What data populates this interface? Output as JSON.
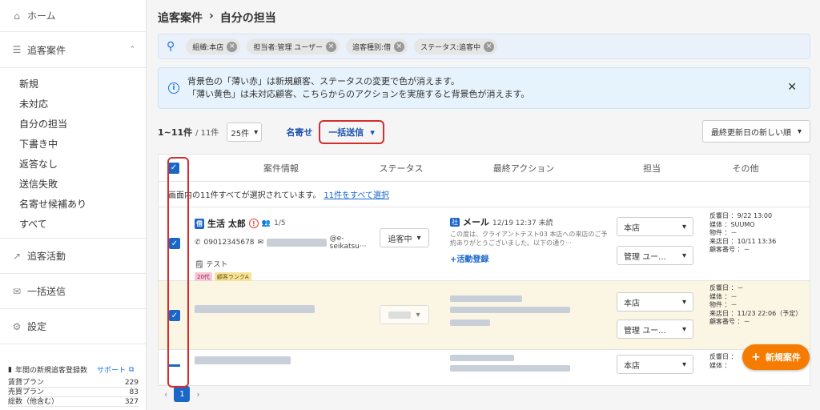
{
  "sidebar": {
    "home": "ホーム",
    "section_title": "追客案件",
    "sub_items": [
      "新規",
      "未対応",
      "自分の担当",
      "下書き中",
      "返答なし",
      "送信失敗",
      "名寄せ候補あり",
      "すべて"
    ],
    "activity": "追客活動",
    "bulk_send": "一括送信",
    "settings": "設定",
    "footer": {
      "title": "年間の新規追客登録数",
      "support": "サポート",
      "rows": [
        {
          "label": "賃貸プラン",
          "value": "229"
        },
        {
          "label": "売買プラン",
          "value": "83"
        },
        {
          "label": "総数（他含む）",
          "value": "327"
        }
      ]
    }
  },
  "breadcrumb": {
    "parent": "追客案件",
    "sep": "›",
    "current": "自分の担当"
  },
  "filters": [
    "組織:本店",
    "担当者:管理 ユーザー",
    "追客種別:借",
    "ステータス:追客中"
  ],
  "notice": {
    "line1": "背景色の「薄い赤」は新規顧客、ステータスの変更で色が消えます。",
    "line2": "「薄い黄色」は未対応顧客、こちらからのアクションを実施すると背景色が消えます。"
  },
  "toolbar": {
    "count": "1~11件",
    "total": "/ 11件",
    "per_page": "25件",
    "merge": "名寄せ",
    "bulk_send": "一括送信",
    "sort": "最終更新日の新しい順"
  },
  "table": {
    "headers": [
      "案件情報",
      "ステータス",
      "最終アクション",
      "担当",
      "その他"
    ],
    "select_note": "画面内の11件すべてが選択されています。",
    "select_all_link": "11件をすべて選択",
    "row1": {
      "tag": "借",
      "name": "生活 太郎",
      "count": "1/5",
      "phone": "09012345678",
      "email_suffix": "@e-seikatsu···",
      "memo": "テスト",
      "badges": [
        "20代",
        "顧客ランクA"
      ],
      "status": "追客中",
      "action_tag": "社",
      "action_type": "メール",
      "action_time": "12/19 12:37 未読",
      "action_body": "この度は、クライアントテスト03 本店への来店のご予約ありがとうございました。以下の通り···",
      "add_activity": "+活動登録",
      "store": "本店",
      "manager": "管理 ユー...",
      "other": [
        {
          "k": "反響日",
          "v": "：9/22 13:00"
        },
        {
          "k": "媒体",
          "v": "：SUUMO"
        },
        {
          "k": "物件",
          "v": "：－"
        },
        {
          "k": "来店日",
          "v": "：10/11 13:36"
        },
        {
          "k": "顧客番号",
          "v": "：－"
        }
      ]
    },
    "row2": {
      "store": "本店",
      "manager": "管理 ユー...",
      "other": [
        {
          "k": "反響日",
          "v": "：－"
        },
        {
          "k": "媒体",
          "v": "：－"
        },
        {
          "k": "物件",
          "v": "：－"
        },
        {
          "k": "来店日",
          "v": "：11/23 22:06（予定）"
        },
        {
          "k": "顧客番号",
          "v": "：－"
        }
      ]
    },
    "row3": {
      "store": "本店",
      "other": [
        {
          "k": "反響日",
          "v": "："
        },
        {
          "k": "媒体",
          "v": "："
        }
      ]
    }
  },
  "pager": {
    "prev": "‹",
    "page": "1",
    "next": "›"
  },
  "fab": {
    "label": "新規案件"
  },
  "colors": {
    "accent": "#1a66c9",
    "highlight_red": "#d32f2f",
    "fab_orange": "#f57c00",
    "unhandled_yellow": "#fbf6e3"
  }
}
